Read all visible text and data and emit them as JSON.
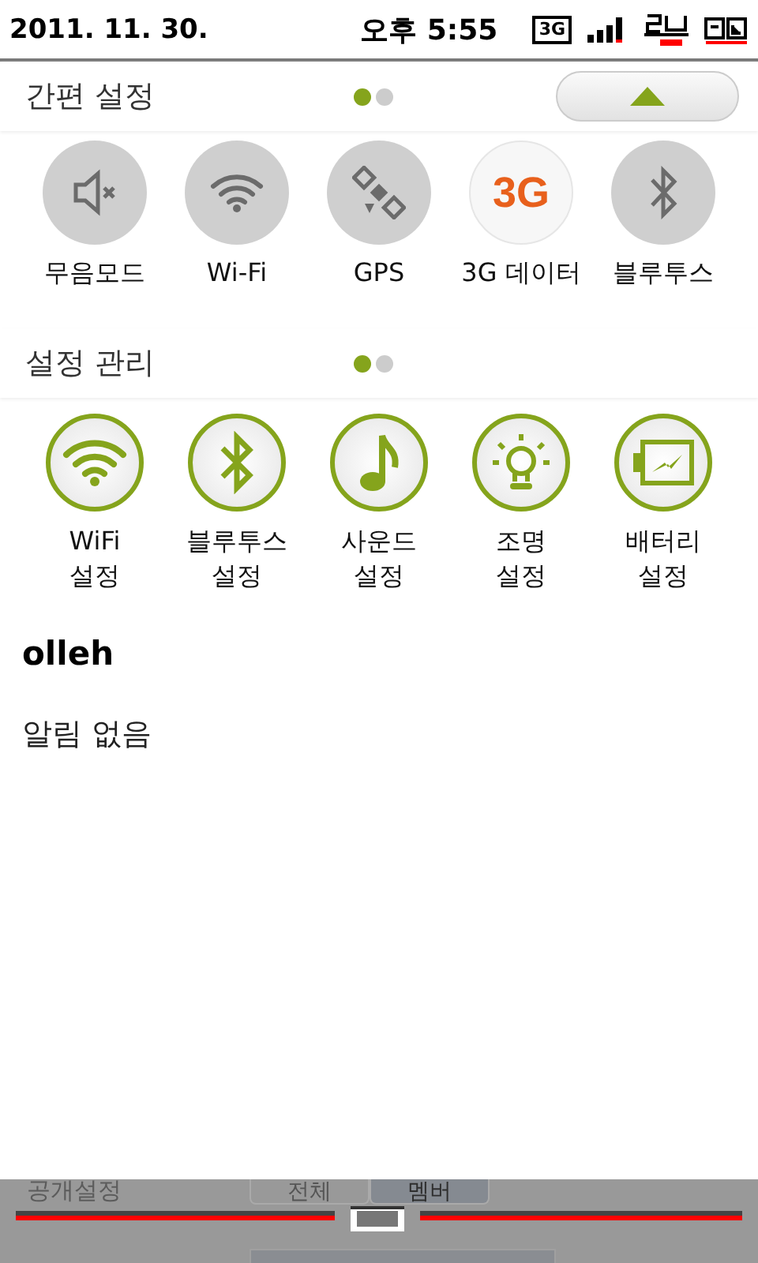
{
  "status_bar": {
    "date": "2011. 11. 30.",
    "time": "오후 5:55",
    "network": "3G"
  },
  "quick_settings": {
    "title": "간편 설정",
    "pages": [
      {
        "selected": true
      },
      {
        "selected": false
      }
    ],
    "toggles": [
      {
        "kind": "mute",
        "label": "무음모드",
        "on": false
      },
      {
        "kind": "wifi",
        "label": "Wi-Fi",
        "on": false
      },
      {
        "kind": "gps",
        "label": "GPS",
        "on": false
      },
      {
        "kind": "text",
        "glyph": "3G",
        "label": "3G 데이터",
        "on": true
      },
      {
        "kind": "bluetooth",
        "label": "블루투스",
        "on": false
      }
    ]
  },
  "settings_manager": {
    "title": "설정 관리",
    "pages": [
      {
        "selected": true
      },
      {
        "selected": false
      }
    ],
    "items": [
      {
        "kind": "wifi",
        "label": "WiFi\n설정"
      },
      {
        "kind": "bluetooth",
        "label": "블루투스\n설정"
      },
      {
        "kind": "sound",
        "label": "사운드\n설정"
      },
      {
        "kind": "light",
        "label": "조명\n설정"
      },
      {
        "kind": "battery",
        "label": "배터리\n설정"
      }
    ]
  },
  "notifications": {
    "carrier": "olleh",
    "message": "알림 없음"
  },
  "background_page": {
    "title": "공개설정",
    "tabs": [
      {
        "label": "전체",
        "selected": false
      },
      {
        "label": "멤버",
        "selected": true
      }
    ]
  }
}
